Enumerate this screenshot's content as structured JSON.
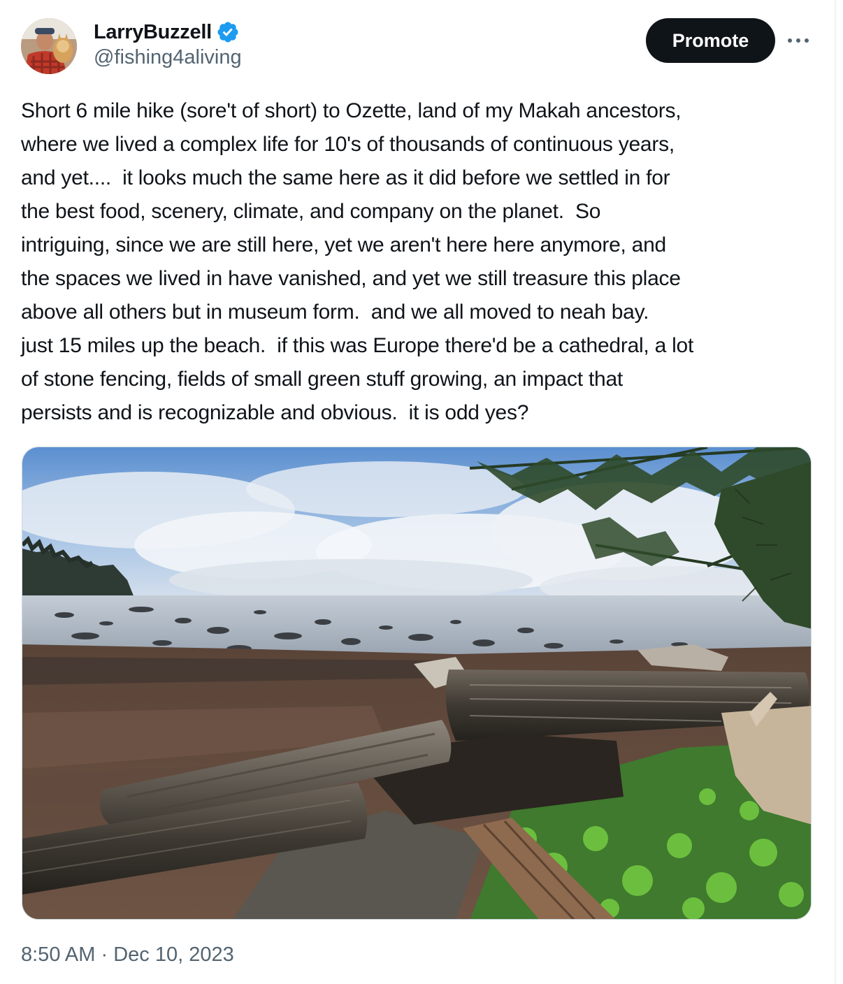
{
  "author": {
    "display_name": "LarryBuzzell",
    "handle": "@fishing4aliving",
    "verified": true,
    "avatar": "avatar-photo"
  },
  "actions": {
    "promote_label": "Promote",
    "more_icon": "more-horizontal-icon"
  },
  "tweet": {
    "text": "Short 6 mile hike (sore't of short) to Ozette, land of my Makah ancestors,\nwhere we lived a complex life for 10's of thousands of continuous years,\nand yet....  it looks much the same here as it did before we settled in for\nthe best food, scenery, climate, and company on the planet.  So\nintriguing, since we are still here, yet we aren't here here anymore, and\nthe spaces we lived in have vanished, and yet we still treasure this place\nabove all others but in museum form.  and we all moved to neah bay.\njust 15 miles up the beach.  if this was Europe there'd be a cathedral, a lot\nof stone fencing, fields of small green stuff growing, an impact that\npersists and is recognizable and obvious.  it is odd yes?",
    "time": "8:50 AM",
    "separator": "·",
    "date": "Dec 10, 2023"
  },
  "colors": {
    "text": "#0f1419",
    "secondary": "#536471",
    "verified_blue": "#1d9bf0",
    "button_bg": "#0f1419"
  }
}
